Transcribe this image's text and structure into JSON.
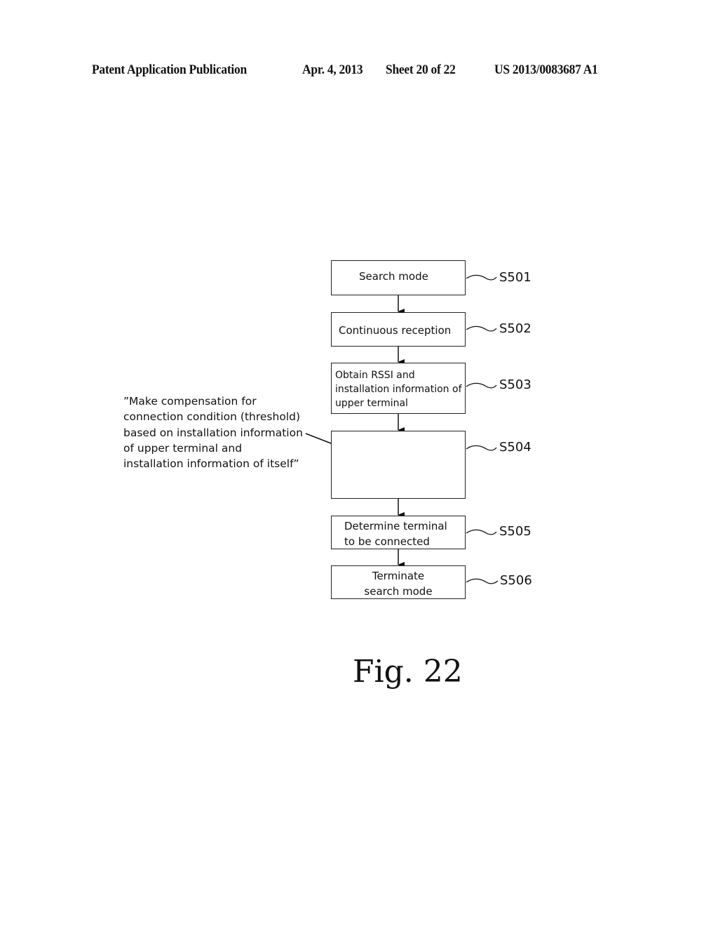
{
  "header": {
    "publication": "Patent Application Publication",
    "date": "Apr. 4, 2013",
    "sheet": "Sheet 20 of 22",
    "number": "US 2013/0083687 A1"
  },
  "flowchart": {
    "steps": [
      {
        "id": "S501",
        "lines": [
          "Search mode"
        ]
      },
      {
        "id": "S502",
        "lines": [
          "Continuous reception"
        ]
      },
      {
        "id": "S503",
        "lines": [
          "Obtain RSSI and",
          "installation information of",
          "upper terminal"
        ]
      },
      {
        "id": "S504",
        "lines": []
      },
      {
        "id": "S505",
        "lines": [
          "Determine terminal",
          "to be connected"
        ]
      },
      {
        "id": "S506",
        "lines": [
          "Terminate",
          "search mode"
        ]
      }
    ],
    "annotation": {
      "target": "S504",
      "text": "”Make compensation for\nconnection condition (threshold)\nbased on installation information\nof upper terminal and\ninstallation information of itself”"
    }
  },
  "figure_label": "Fig. 22"
}
